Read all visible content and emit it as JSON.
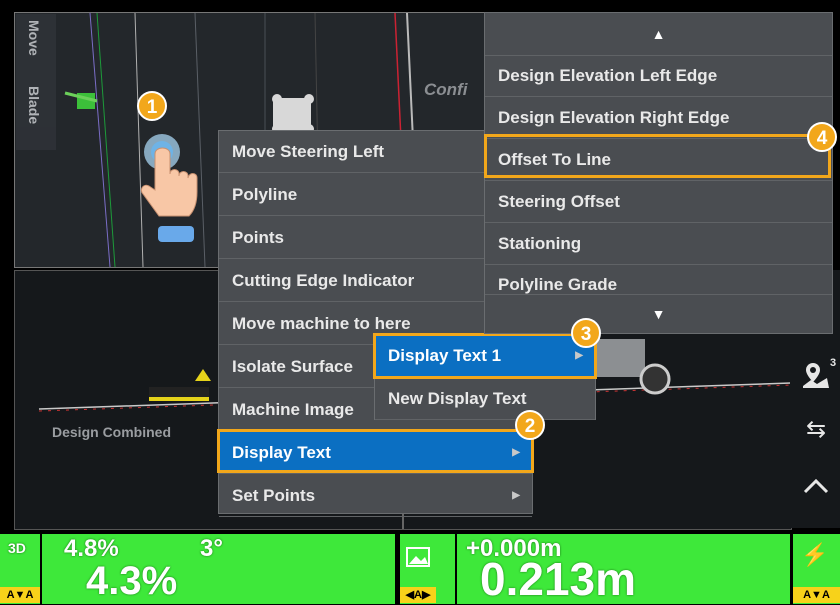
{
  "plan_view": {
    "vertical_tab_1": "Move",
    "vertical_tab_2": "Blade",
    "faded_label": "Confi"
  },
  "profile_view": {
    "design_label": "Design Combined",
    "right_number": "2"
  },
  "context_menu": {
    "items": [
      {
        "label": "Move Steering Left",
        "submenu": false
      },
      {
        "label": "Polyline",
        "submenu": false
      },
      {
        "label": "Points",
        "submenu": false
      },
      {
        "label": "Cutting Edge Indicator",
        "submenu": false
      },
      {
        "label": "Move machine to here",
        "submenu": false
      },
      {
        "label": "Isolate Surface",
        "submenu": false
      },
      {
        "label": "Machine Image",
        "submenu": false
      },
      {
        "label": "Display Text",
        "submenu": true,
        "selected": true
      },
      {
        "label": "Set Points",
        "submenu": true
      }
    ],
    "submenu_arrow": "▶"
  },
  "display_text_submenu": {
    "items": [
      {
        "label": "Display Text 1",
        "submenu": true,
        "selected": true
      },
      {
        "label": "New Display Text",
        "submenu": false
      }
    ]
  },
  "option_list": {
    "scroll_up": "▲",
    "scroll_down": "▼",
    "items": [
      "Design Elevation Left Edge",
      "Design Elevation Right Edge",
      "Offset To Line",
      "Steering Offset",
      "Stationing",
      "Polyline Grade"
    ],
    "highlighted_index": 2
  },
  "steps": {
    "step1": "1",
    "step2": "2",
    "step3": "3",
    "step4": "4"
  },
  "right_toolbar": {
    "badge_number": "3"
  },
  "status_bar": {
    "mode_label": "3D",
    "slope_small": "4.8%",
    "cross_small": "3°",
    "slope_large": "4.3%",
    "elev_small": "+0.000m",
    "elev_large": "0.213m",
    "ab_left": "A▼A",
    "ab_mid": "◀A▶",
    "ab_right": "A▼A"
  },
  "colors": {
    "status_green": "#3ee83a",
    "highlight_orange": "#f2a71b",
    "selection_blue": "#0b6fc2",
    "menu_gray": "#4a4d51"
  }
}
